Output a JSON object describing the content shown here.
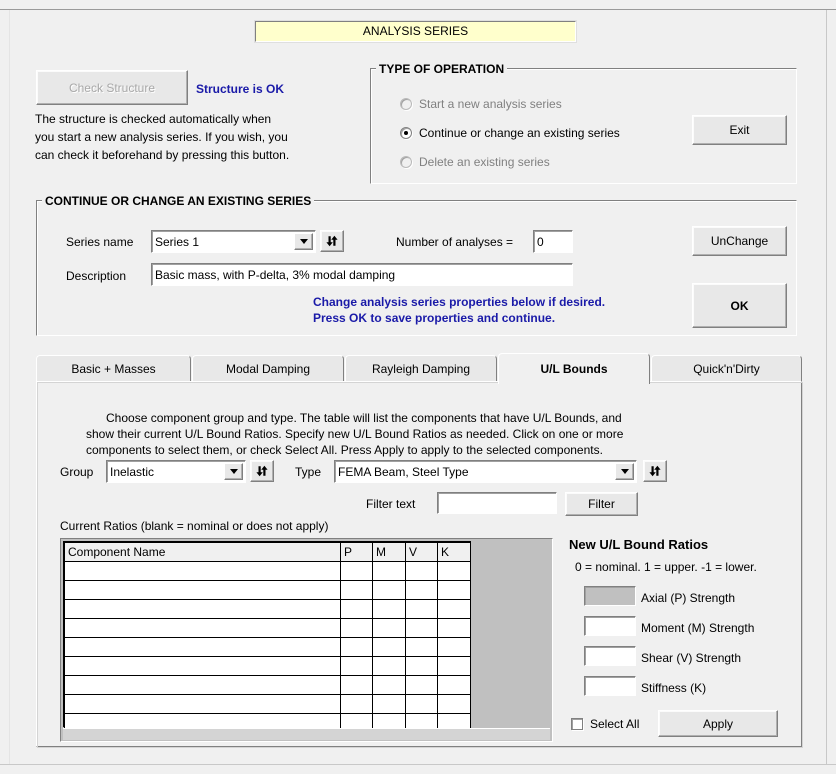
{
  "window": {
    "title": "ANALYSIS SERIES"
  },
  "check_panel": {
    "button_label": "Check Structure",
    "button_enabled": false,
    "status_text": "Structure is OK",
    "status_color": "#1a1aa8",
    "help_line1": "The structure is checked automatically when",
    "help_line2": "you start a new analysis series. If you wish, you",
    "help_line3": "can check it beforehand by pressing this button."
  },
  "type_of_operation": {
    "title": "TYPE OF OPERATION",
    "options": [
      {
        "label": "Start a new analysis series",
        "selected": false,
        "enabled": false
      },
      {
        "label": "Continue or change an existing series",
        "selected": true,
        "enabled": true
      },
      {
        "label": "Delete an existing series",
        "selected": false,
        "enabled": false
      }
    ],
    "exit_label": "Exit"
  },
  "continue_section": {
    "title": "CONTINUE OR CHANGE AN EXISTING SERIES",
    "series_name_label": "Series name",
    "series_name_value": "Series 1",
    "series_refresh_icon": "refresh-icon",
    "number_of_analyses_label": "Number of analyses =",
    "number_of_analyses_value": "0",
    "description_label": "Description",
    "description_value": "Basic mass, with P-delta, 3% modal damping",
    "hint_line1": "Change analysis series properties below if desired.",
    "hint_line2": "Press OK to save properties and continue.",
    "hint_color": "#1a1aa8",
    "unchange_label": "UnChange",
    "ok_label": "OK"
  },
  "tabs": [
    {
      "label": "Basic + Masses",
      "active": false
    },
    {
      "label": "Modal  Damping",
      "active": false
    },
    {
      "label": "Rayleigh Damping",
      "active": false
    },
    {
      "label": "U/L Bounds",
      "active": true
    },
    {
      "label": "Quick'n'Dirty",
      "active": false
    }
  ],
  "ul_bounds": {
    "instructions_line1": "Choose component group and type. The table will list the components that have U/L Bounds, and",
    "instructions_line2": "show their current U/L Bound Ratios. Specify new U/L Bound Ratios as needed. Click on one or more",
    "instructions_line3": "components to select them, or check Select All.  Press Apply to apply to the selected components.",
    "group_label": "Group",
    "group_value": "Inelastic",
    "group_refresh_icon": "refresh-icon",
    "type_label": "Type",
    "type_value": "FEMA Beam, Steel Type",
    "type_refresh_icon": "refresh-icon",
    "filter_text_label": "Filter text",
    "filter_text_value": "",
    "filter_button_label": "Filter",
    "current_ratios_label": "Current Ratios (blank = nominal or does not apply)",
    "table": {
      "columns": [
        "Component Name",
        "P",
        "M",
        "V",
        "K"
      ],
      "rows": [
        [
          "",
          "",
          "",
          "",
          ""
        ],
        [
          "",
          "",
          "",
          "",
          ""
        ],
        [
          "",
          "",
          "",
          "",
          ""
        ],
        [
          "",
          "",
          "",
          "",
          ""
        ],
        [
          "",
          "",
          "",
          "",
          ""
        ],
        [
          "",
          "",
          "",
          "",
          ""
        ],
        [
          "",
          "",
          "",
          "",
          ""
        ],
        [
          "",
          "",
          "",
          "",
          ""
        ],
        [
          "",
          "",
          "",
          "",
          ""
        ]
      ]
    },
    "new_ratios": {
      "heading": "New U/L Bound Ratios",
      "legend": "0 = nominal. 1 = upper. -1 = lower.",
      "fields": [
        {
          "label": "Axial (P) Strength",
          "value": "",
          "enabled": false
        },
        {
          "label": "Moment (M) Strength",
          "value": "",
          "enabled": true
        },
        {
          "label": "Shear (V) Strength",
          "value": "",
          "enabled": true
        },
        {
          "label": "Stiffness (K)",
          "value": "",
          "enabled": true
        }
      ]
    },
    "select_all_label": "Select All",
    "select_all_checked": false,
    "apply_label": "Apply"
  }
}
